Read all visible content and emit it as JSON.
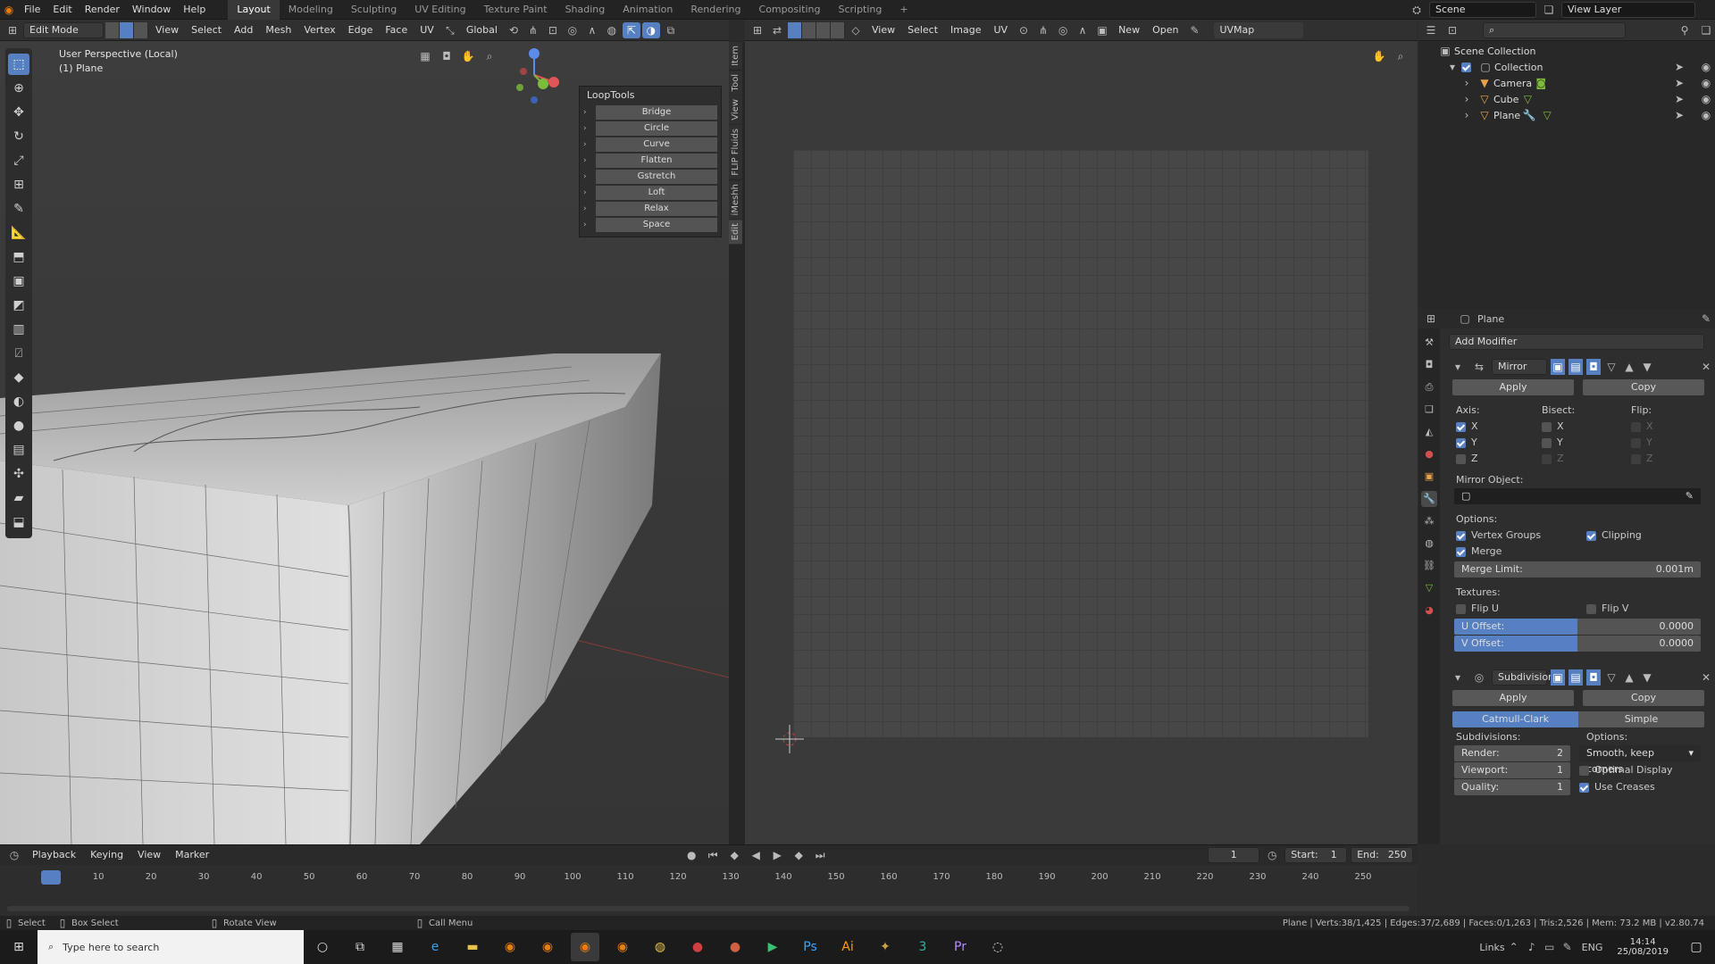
{
  "menubar": {
    "items": [
      "File",
      "Edit",
      "Render",
      "Window",
      "Help"
    ],
    "workspaces": [
      "Layout",
      "Modeling",
      "Sculpting",
      "UV Editing",
      "Texture Paint",
      "Shading",
      "Animation",
      "Rendering",
      "Compositing",
      "Scripting"
    ],
    "active_workspace": "Layout",
    "add": "+",
    "scene": "Scene",
    "view_layer": "View Layer"
  },
  "viewport3d": {
    "mode": "Edit Mode",
    "menus": [
      "View",
      "Select",
      "Add",
      "Mesh",
      "Vertex",
      "Edge",
      "Face",
      "UV"
    ],
    "orientation": "Global",
    "perspective": "User Perspective (Local)",
    "object": "(1) Plane"
  },
  "looptools": {
    "title": "LoopTools",
    "items": [
      "Bridge",
      "Circle",
      "Curve",
      "Flatten",
      "Gstretch",
      "Loft",
      "Relax",
      "Space"
    ]
  },
  "side_tabs": [
    "Item",
    "Tool",
    "View",
    "FLIP Fluids",
    "iMeshh",
    "Edit"
  ],
  "uv_editor": {
    "menus": [
      "View",
      "Select",
      "Image",
      "UV"
    ],
    "new": "New",
    "open": "Open",
    "uvmap": "UVMap"
  },
  "outliner": {
    "root": "Scene Collection",
    "collection": "Collection",
    "objects": [
      "Camera",
      "Cube",
      "Plane"
    ]
  },
  "properties": {
    "object": "Plane",
    "add_modifier": "Add Modifier",
    "mirror": {
      "name": "Mirror",
      "apply": "Apply",
      "copy": "Copy",
      "axis_label": "Axis:",
      "bisect_label": "Bisect:",
      "flip_label": "Flip:",
      "axes": [
        "X",
        "Y",
        "Z"
      ],
      "mirror_object_label": "Mirror Object:",
      "options_label": "Options:",
      "vertex_groups": "Vertex Groups",
      "clipping": "Clipping",
      "merge": "Merge",
      "merge_limit_label": "Merge Limit:",
      "merge_limit": "0.001m",
      "textures_label": "Textures:",
      "flip_u": "Flip U",
      "flip_v": "Flip V",
      "u_offset_label": "U Offset:",
      "u_offset": "0.0000",
      "v_offset_label": "V Offset:",
      "v_offset": "0.0000"
    },
    "subdivision": {
      "name": "Subdivision",
      "apply": "Apply",
      "copy": "Copy",
      "catmull": "Catmull-Clark",
      "simple": "Simple",
      "subdivisions_label": "Subdivisions:",
      "options_label": "Options:",
      "render_label": "Render:",
      "render": "2",
      "viewport_label": "Viewport:",
      "viewport": "1",
      "quality_label": "Quality:",
      "quality": "1",
      "uv_smooth": "Smooth, keep corners",
      "optimal_display": "Optimal Display",
      "use_creases": "Use Creases"
    }
  },
  "timeline": {
    "menus": [
      "Playback",
      "Keying",
      "View",
      "Marker"
    ],
    "current_frame": "1",
    "start_label": "Start:",
    "start": "1",
    "end_label": "End:",
    "end": "250",
    "ticks": [
      "1",
      "10",
      "20",
      "30",
      "40",
      "50",
      "60",
      "70",
      "80",
      "90",
      "100",
      "110",
      "120",
      "130",
      "140",
      "150",
      "160",
      "170",
      "180",
      "190",
      "200",
      "210",
      "220",
      "230",
      "240",
      "250"
    ]
  },
  "statusbar": {
    "select": "Select",
    "box_select": "Box Select",
    "rotate_view": "Rotate View",
    "call_menu": "Call Menu",
    "stats": "Plane | Verts:38/1,425 | Edges:37/2,689 | Faces:0/1,263 | Tris:2,526 | Mem: 73.2 MB | v2.80.74"
  },
  "taskbar": {
    "search_placeholder": "Type here to search",
    "links": "Links",
    "lang": "ENG",
    "time": "14:14",
    "date": "25/08/2019"
  }
}
